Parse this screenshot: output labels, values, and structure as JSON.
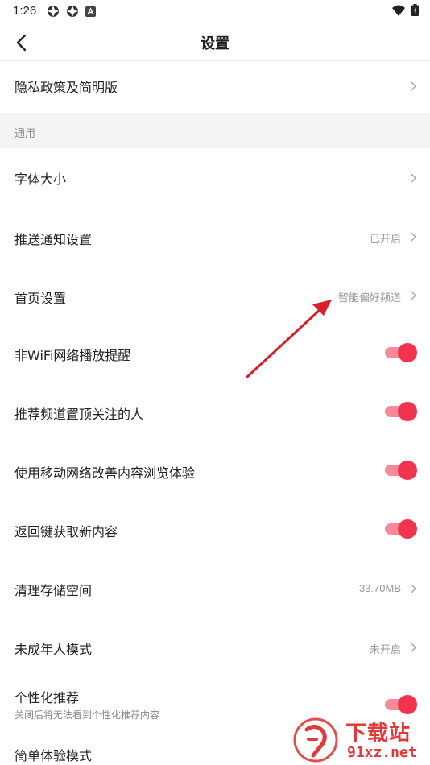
{
  "status_bar": {
    "time": "1:26"
  },
  "header": {
    "title": "设置"
  },
  "rows": {
    "privacy": {
      "label": "隐私政策及简明版"
    },
    "section_general": "通用",
    "font_size": {
      "label": "字体大小"
    },
    "push": {
      "label": "推送通知设置",
      "value": "已开启"
    },
    "homepage": {
      "label": "首页设置",
      "value": "智能偏好频道"
    },
    "non_wifi": {
      "label": "非WiFi网络播放提醒",
      "enabled": true
    },
    "pin_followed": {
      "label": "推荐频道置顶关注的人",
      "enabled": true
    },
    "mobile_network": {
      "label": "使用移动网络改善内容浏览体验",
      "enabled": true
    },
    "back_refresh": {
      "label": "返回键获取新内容",
      "enabled": true
    },
    "storage": {
      "label": "清理存储空间",
      "value": "33.70MB"
    },
    "minor_mode": {
      "label": "未成年人模式",
      "value": "未开启"
    },
    "personalized": {
      "label": "个性化推荐",
      "sub": "关闭后将无法看到个性化推荐内容",
      "enabled": true
    },
    "simple_mode": {
      "label": "简单体验模式"
    }
  },
  "watermark": {
    "brand": "下载站",
    "site": "91xz.net"
  },
  "colors": {
    "accent": "#f2334f",
    "track": "#f58b9a",
    "annotation": "#d81e2a"
  }
}
